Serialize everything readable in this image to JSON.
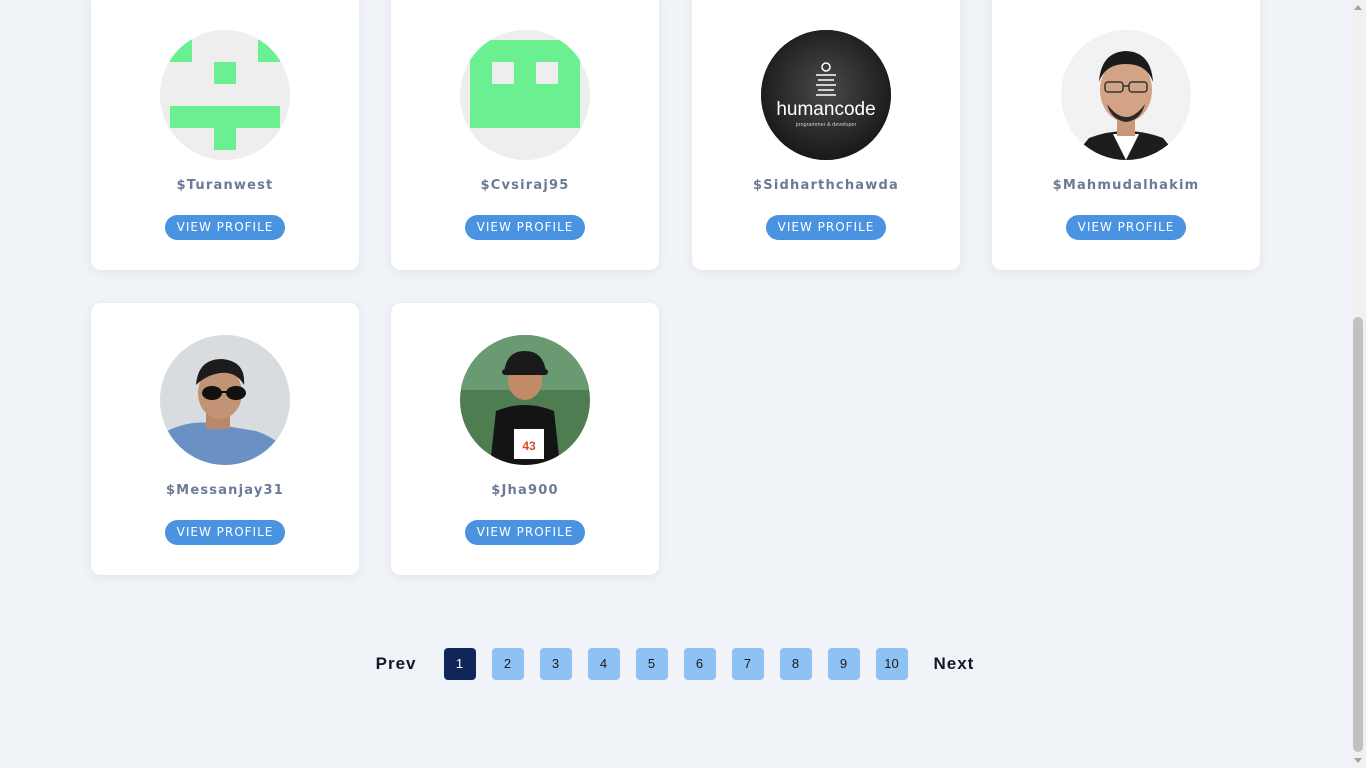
{
  "profiles": [
    {
      "username": "$Turanwest",
      "button": "VIEW PROFILE",
      "avatar": "identicon-avatar"
    },
    {
      "username": "$Cvsiraj95",
      "button": "VIEW PROFILE",
      "avatar": "identicon-avatar"
    },
    {
      "username": "$Sidharthchawda",
      "button": "VIEW PROFILE",
      "avatar": "humancode-logo-avatar",
      "avatar_text": "humancode",
      "avatar_subtext": "programmer & developer"
    },
    {
      "username": "$Mahmudalhakim",
      "button": "VIEW PROFILE",
      "avatar": "photo-avatar"
    },
    {
      "username": "$Messanjay31",
      "button": "VIEW PROFILE",
      "avatar": "photo-avatar"
    },
    {
      "username": "$Jha900",
      "button": "VIEW PROFILE",
      "avatar": "photo-avatar",
      "bib_number": "43"
    }
  ],
  "pagination": {
    "prev": "Prev",
    "next": "Next",
    "pages": [
      "1",
      "2",
      "3",
      "4",
      "5",
      "6",
      "7",
      "8",
      "9",
      "10"
    ],
    "current": "1"
  },
  "colors": {
    "background": "#f0f3f7",
    "button": "#4a93e0",
    "username": "#6b7b96",
    "page_active": "#10265a",
    "page_inactive": "#8ec2f4",
    "identicon": "#6af090"
  }
}
